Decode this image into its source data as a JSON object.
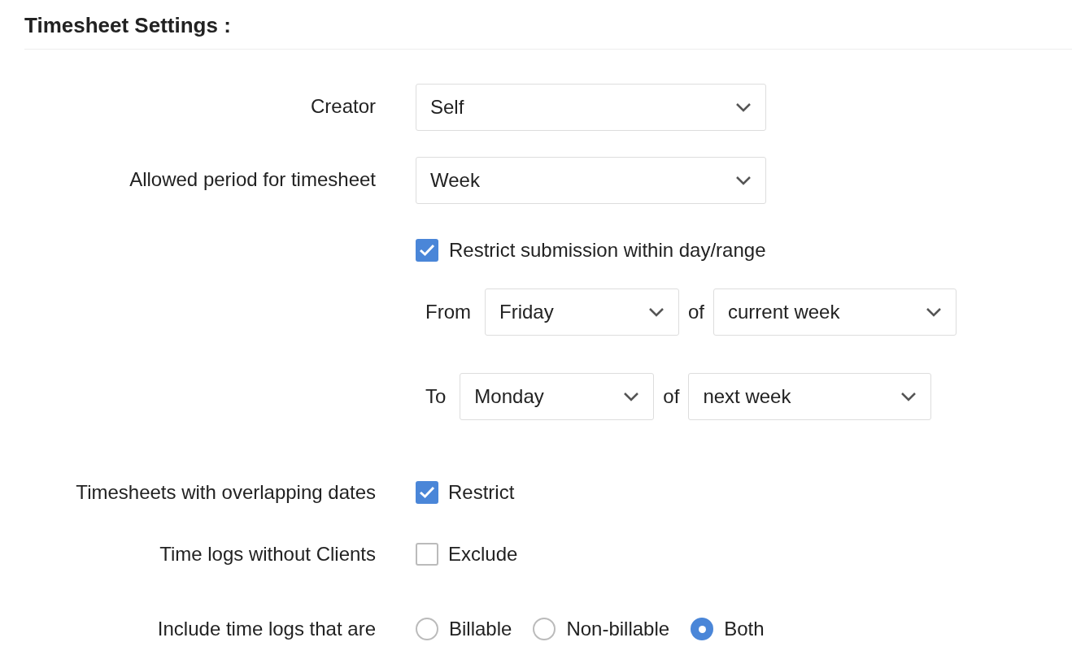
{
  "title": "Timesheet Settings :",
  "selects": [
    {
      "label": "Creator",
      "value": "Self"
    },
    {
      "label": "Allowed period for timesheet",
      "value": "Week"
    }
  ],
  "restrict_submission": {
    "label": "Restrict submission within day/range",
    "checked": true,
    "ranges": [
      {
        "label": "From",
        "day": "Friday",
        "connector": "of",
        "week": "current week"
      },
      {
        "label": "To",
        "day": "Monday",
        "connector": "of",
        "week": "next week"
      }
    ]
  },
  "options": [
    {
      "kind": "checkbox",
      "label": "Timesheets with overlapping dates",
      "option": "Restrict",
      "checked": true
    },
    {
      "kind": "checkbox",
      "label": "Time logs without Clients",
      "option": "Exclude",
      "checked": false
    },
    {
      "kind": "radio",
      "label": "Include time logs that are",
      "choices": [
        {
          "label": "Billable",
          "selected": false
        },
        {
          "label": "Non-billable",
          "selected": false
        },
        {
          "label": "Both",
          "selected": true
        }
      ]
    }
  ]
}
